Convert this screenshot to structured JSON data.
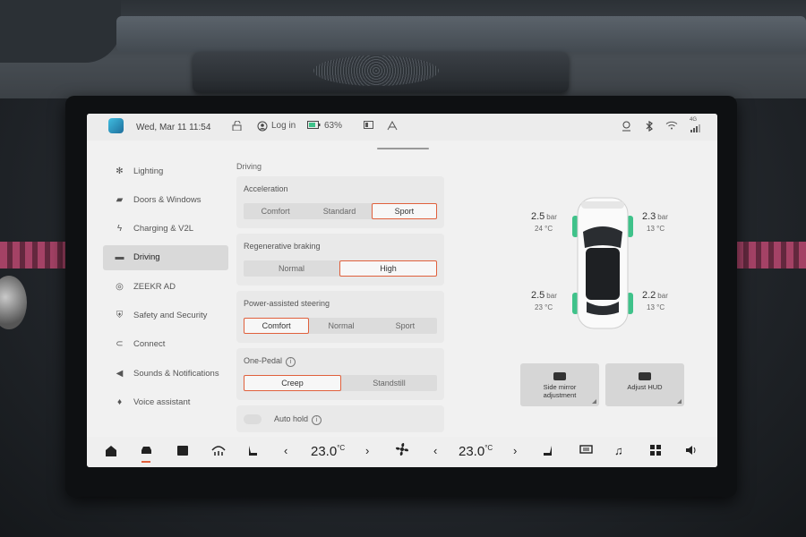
{
  "status_bar": {
    "date_time": "Wed, Mar 11 11:54",
    "login_label": "Log in",
    "battery": "63%",
    "network": "4G",
    "icons": [
      "unlock-icon",
      "user-icon",
      "battery-icon",
      "screen-icon",
      "wipers-icon",
      "location-icon",
      "bluetooth-icon",
      "wifi-icon",
      "signal-icon"
    ]
  },
  "sidebar": {
    "items": [
      {
        "label": "Lighting",
        "icon": "light-icon"
      },
      {
        "label": "Doors & Windows",
        "icon": "door-icon"
      },
      {
        "label": "Charging & V2L",
        "icon": "charging-icon"
      },
      {
        "label": "Driving",
        "icon": "car-icon",
        "active": true
      },
      {
        "label": "ZEEKR AD",
        "icon": "steering-icon"
      },
      {
        "label": "Safety and Security",
        "icon": "shield-icon"
      },
      {
        "label": "Connect",
        "icon": "link-icon"
      },
      {
        "label": "Sounds & Notifications",
        "icon": "speaker-icon"
      },
      {
        "label": "Voice assistant",
        "icon": "mic-icon"
      }
    ]
  },
  "driving": {
    "section_title": "Driving",
    "acceleration": {
      "label": "Acceleration",
      "options": [
        "Comfort",
        "Standard",
        "Sport"
      ],
      "selected": "Sport"
    },
    "regen": {
      "label": "Regenerative braking",
      "options": [
        "Normal",
        "High"
      ],
      "selected": "High"
    },
    "steering": {
      "label": "Power-assisted steering",
      "options": [
        "Comfort",
        "Normal",
        "Sport"
      ],
      "selected": "Comfort"
    },
    "one_pedal": {
      "label": "One-Pedal",
      "options": [
        "Creep",
        "Standstill"
      ],
      "selected": "Creep"
    },
    "auto_hold": {
      "label": "Auto hold",
      "enabled": false
    }
  },
  "tires": {
    "front_left": {
      "pressure": "2.5",
      "unit": "bar",
      "temp": "24 °C"
    },
    "front_right": {
      "pressure": "2.3",
      "unit": "bar",
      "temp": "13 °C"
    },
    "rear_left": {
      "pressure": "2.5",
      "unit": "bar",
      "temp": "23 °C"
    },
    "rear_right": {
      "pressure": "2.2",
      "unit": "bar",
      "temp": "13 °C"
    },
    "tire_color": "#3fc28a"
  },
  "quick_buttons": {
    "mirror": "Side mirror\nadjustment",
    "hud": "Adjust HUD"
  },
  "dock": {
    "left_temp": "23.0",
    "right_temp": "23.0",
    "temp_unit": "°C",
    "accent": "#e0603c"
  }
}
